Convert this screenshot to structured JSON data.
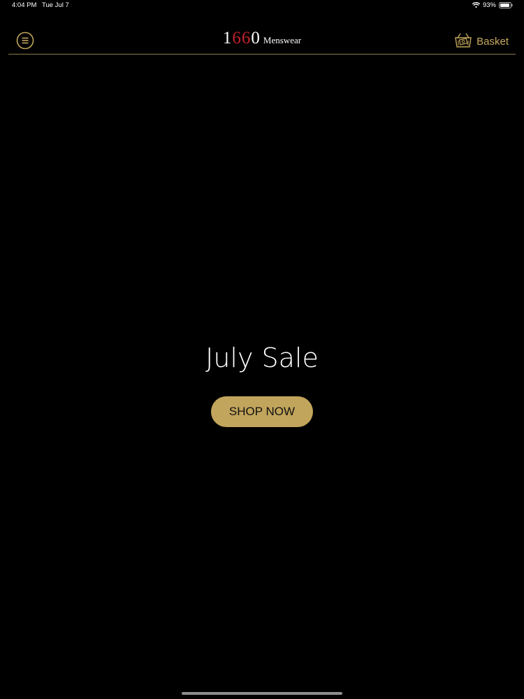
{
  "status_bar": {
    "time": "4:04 PM",
    "date": "Tue Jul 7",
    "battery": "93%",
    "battery_level": 0.93
  },
  "header": {
    "logo": {
      "digit1": "1",
      "digit2": "6",
      "digit3": "6",
      "digit4": "0",
      "word": "Menswear"
    },
    "basket_label": "Basket",
    "menu_icon": "hamburger-circle-icon",
    "basket_icon": "basket-icon"
  },
  "hero": {
    "title": "July Sale",
    "cta_label": "SHOP NOW"
  },
  "colors": {
    "background": "#000000",
    "accent_gold": "#c2a55c",
    "logo_red": "#c0202a",
    "divider": "#8a7a4a"
  }
}
